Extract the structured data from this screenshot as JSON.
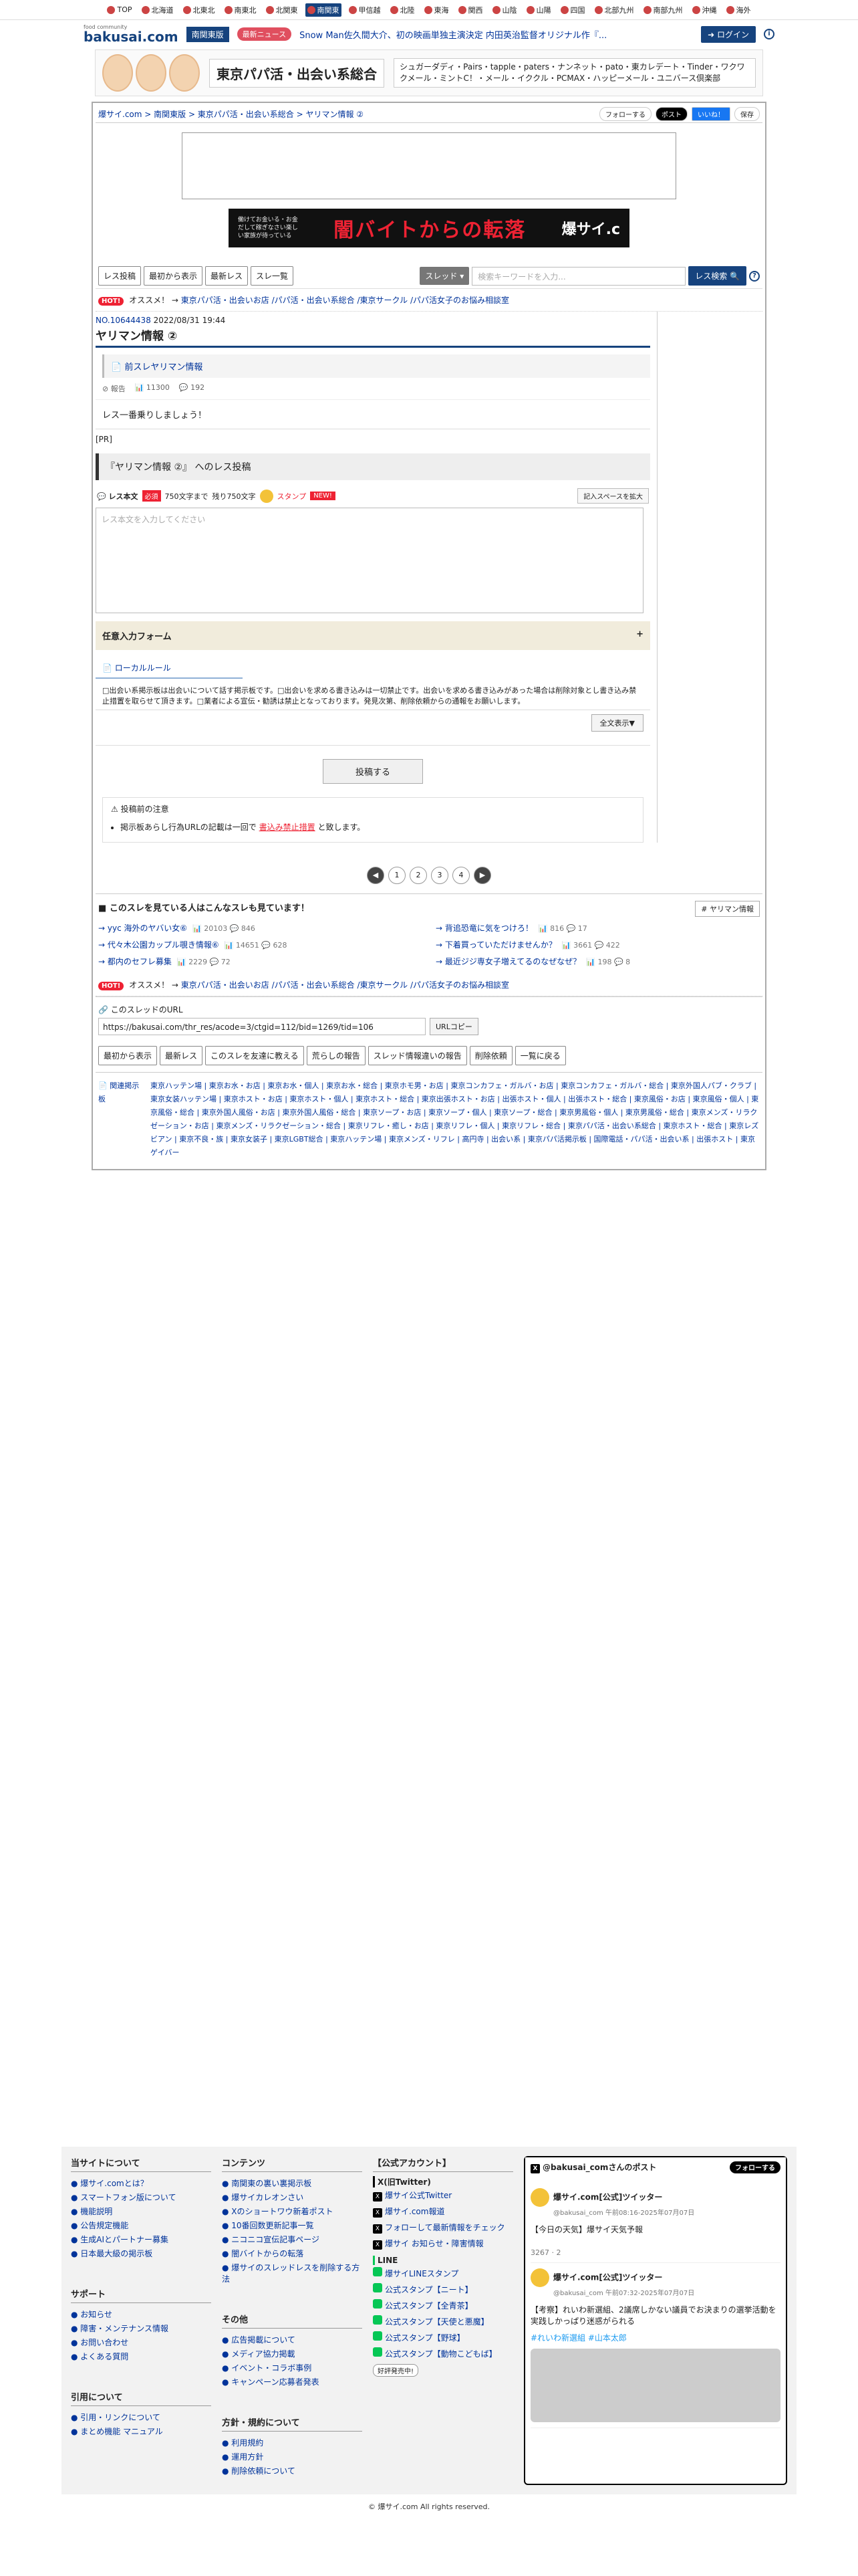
{
  "regions": [
    "TOP",
    "北海道",
    "北東北",
    "南東北",
    "北関東",
    "南関東",
    "甲信越",
    "北陸",
    "東海",
    "関西",
    "山陰",
    "山陽",
    "四国",
    "北部九州",
    "南部九州",
    "沖縄",
    "海外"
  ],
  "header": {
    "logo_top": "food community",
    "logo": "bakusai.com",
    "area": "南関東版",
    "news_tag": "最新ニュース",
    "news": "Snow Man佐久間大介、初の映画単独主演決定 内田英治監督オリジナル作『...",
    "login": "ログイン"
  },
  "topad": {
    "title": "東京パパ活・出会い系総合",
    "desc": "シュガーダディ・Pairs・tapple・paters・ナンネット・pato・東カレデート・Tinder・ワクワクメール・ミントC！・メール・イククル・PCMAX・ハッピーメール・ユニバース倶楽部"
  },
  "breadcrumb": "爆サイ.com > 南関東版 > 東京パパ活・出会い系総合 > ヤリマン情報 ②",
  "share": {
    "follow": "フォローする",
    "post": "ポスト",
    "like": "いいね！",
    "save": "保存"
  },
  "promo": {
    "left": "働けてお金いる・お金だして稼ぎなさい楽しい家族が待っている",
    "title": "闇バイトからの転落",
    "logo": "爆サイ.c"
  },
  "toolbar": {
    "buttons": [
      "レス投稿",
      "最初から表示",
      "最新レス",
      "スレ一覧"
    ],
    "select": "スレッド",
    "search_placeholder": "検索キーワードを入力...",
    "search_btn": "レス検索"
  },
  "hot": {
    "label": "HOT!",
    "text": "オススメ！ →",
    "links": "東京パパ活・出会いお店 /パパ活・出会い系総合 /東京サークル /パパ活女子のお悩み相談室"
  },
  "thread": {
    "no": "NO.10644438",
    "date": "2022/08/31 19:44",
    "title": "ヤリマン情報 ②",
    "prev": "前スレヤリマン情報",
    "report": "報告",
    "views": "11300",
    "comments": "192",
    "body": "レス一番乗りしましょう！",
    "pr": "[PR]"
  },
  "form": {
    "title": "『ヤリマン情報 ②』 へのレス投稿",
    "label": "レス本文",
    "req": "必須",
    "limit": "750文字まで",
    "remain": "残り750文字",
    "stamp": "スタンプ",
    "new": "NEW!",
    "expand": "記入スペースを拡大",
    "placeholder": "レス本文を入力してください",
    "optional": "任意入力フォーム",
    "plus": "+",
    "rule_head": "ローカルルール",
    "rule": "□出会い系掲示板は出会いについて話す掲示板です。□出会いを求める書き込みは一切禁止です。出会いを求める書き込みがあった場合は削除対象とし書き込み禁止措置を取らせて頂きます。□業者による宣伝・勧誘は禁止となっております。発見次第、削除依頼からの通報をお願いします。",
    "rule_btn": "全文表示▼",
    "submit": "投稿する",
    "notice_head": "投稿前の注意",
    "notice_pre": "掲示板あらし行為URLの記載は一回で",
    "notice_link": "書込み禁止措置",
    "notice_post": "と致します。"
  },
  "pager": [
    "◀",
    "1",
    "2",
    "3",
    "4",
    "▶"
  ],
  "related": {
    "head": "このスレを見ている人はこんなスレも見ています！",
    "tag": "# ヤリマン情報",
    "items": [
      {
        "title": "yyc 海外のヤバい女⑥",
        "views": "20103",
        "comments": "846"
      },
      {
        "title": "背追恐竜に気をつけろ！",
        "views": "816",
        "comments": "17"
      },
      {
        "title": "代々木公園カップル覗き情報⑥",
        "views": "14651",
        "comments": "628"
      },
      {
        "title": "下着買っていただけませんか？",
        "views": "3661",
        "comments": "422"
      },
      {
        "title": "都内のセフレ募集",
        "views": "2229",
        "comments": "72"
      },
      {
        "title": "最近ジジ専女子増えてるのなぜなぜ？",
        "views": "198",
        "comments": "8"
      }
    ]
  },
  "url": {
    "label": "このスレッドのURL",
    "value": "https://bakusai.com/thr_res/acode=3/ctgid=112/bid=1269/tid=106",
    "copy": "URLコピー"
  },
  "bottom_buttons": [
    "最初から表示",
    "最新レス",
    "このスレを友達に教える",
    "荒らしの報告",
    "スレッド情報違いの報告",
    "削除依頼",
    "一覧に戻る"
  ],
  "links_head": "関連掲示板",
  "links": "東京ハッテン場 | 東京お水・お店 | 東京お水・個人 | 東京お水・総合 | 東京ホモ男・お店 | 東京コンカフェ・ガルバ・お店 | 東京コンカフェ・ガルバ・総合 | 東京外国人パブ・クラブ | 東京女装ハッテン場 | 東京ホスト・お店 | 東京ホスト・個人 | 東京ホスト・総合 | 東京出張ホスト・お店 | 出張ホスト・個人 | 出張ホスト・総合 | 東京風俗・お店 | 東京風俗・個人 | 東京風俗・総合 | 東京外国人風俗・お店 | 東京外国人風俗・総合 | 東京ソープ・お店 | 東京ソープ・個人 | 東京ソープ・総合 | 東京男風俗・個人 | 東京男風俗・総合 | 東京メンズ・リラクゼーション・お店 | 東京メンズ・リラクゼーション・総合 | 東京リフレ・癒し・お店 | 東京リフレ・個人 | 東京リフレ・総合 | 東京パパ活・出会い系総合 | 東京ホスト・総合 | 東京レズビアン | 東京不良・族 | 東京女装子 | 東京LGBT総合 | 東京ハッテン場 | 東京メンズ・リフレ | 高円寺 | 出会い系 | 東京パパ活掲示板 | 国際電話・パパ活・出会い系 | 出張ホスト | 東京ゲイバー",
  "footer": {
    "site_head": "当サイトについて",
    "site": [
      "爆サイ.comとは？",
      "スマートフォン版について",
      "機能説明",
      "公告規定機能",
      "生成AIとパートナー募集",
      "日本最大級の掲示板"
    ],
    "content_head": "コンテンツ",
    "content": [
      "南関東の裏い裏掲示板",
      "爆サイカレオンさい",
      "Xのショートワウ新着ポスト",
      "10番回数更新記事一覧",
      "ニコニコ宣伝記事ページ",
      "闇バイトからの転落",
      "爆サイのスレッドレスを削除する方法"
    ],
    "support_head": "サポート",
    "support": [
      "お知らせ",
      "障害・メンテナンス情報",
      "お問い合わせ",
      "よくある質問"
    ],
    "other_head": "その他",
    "other": [
      "広告掲載について",
      "メディア協力掲載",
      "イベント・コラボ事例",
      "キャンペーン応募者発表"
    ],
    "quote_head": "引用について",
    "quote": [
      "引用・リンクについて",
      "まとめ機能 マニュアル"
    ],
    "policy_head": "方針・規約について",
    "policy": [
      "利用規約",
      "運用方針",
      "削除依頼について"
    ],
    "acct_head": "【公式アカウント】",
    "acct_x": "X(旧Twitter)",
    "acct_items": [
      "爆サイ公式Twitter",
      "爆サイ.com報道",
      "フォローして最新情報をチェック",
      "爆サイ お知らせ・障害情報"
    ],
    "line_head": "LINE",
    "line_items": [
      "爆サイLINEスタンプ",
      "公式スタンプ【ニート】",
      "公式スタンプ【全青茶】",
      "公式スタンプ【天使と悪魔】",
      "公式スタンプ【野球】",
      "公式スタンプ【動物こどもば】"
    ],
    "line_btn": "好評発売中!",
    "tw_head": "@bakusai_comさんのポスト",
    "tw_follow": "フォローする",
    "tw1_name": "爆サイ.com[公式]ツイッター",
    "tw1_handle": "@bakusai_com 午前08:16-2025年07月07日",
    "tw1_text": "【今日の天気】爆サイ天気予報",
    "tw1_stats": "3267 · 2",
    "tw2_name": "爆サイ.com[公式]ツイッター",
    "tw2_handle": "@bakusai_com 午前07:32-2025年07月07日",
    "tw2_text": "【考察】れいわ新選組、2議席しかない議員でお決まりの選挙活動を実践しかっぱり迷惑がられる",
    "tw2_tags": "#れいわ新選組 #山本太郎",
    "copyright": "© 爆サイ.com All rights reserved."
  }
}
